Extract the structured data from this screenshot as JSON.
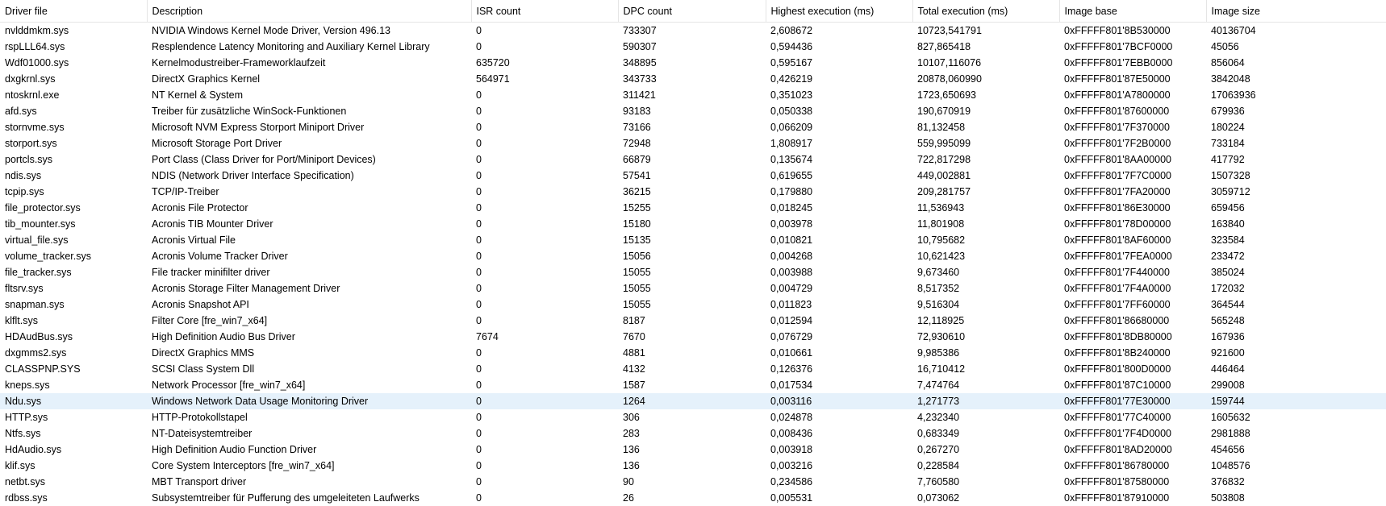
{
  "columns": [
    "Driver file",
    "Description",
    "ISR count",
    "DPC count",
    "Highest execution (ms)",
    "Total execution (ms)",
    "Image base",
    "Image size"
  ],
  "rows": [
    [
      "nvlddmkm.sys",
      "NVIDIA Windows Kernel Mode Driver, Version 496.13",
      "0",
      "733307",
      "2,608672",
      "10723,541791",
      "0xFFFFF801'8B530000",
      "40136704"
    ],
    [
      "rspLLL64.sys",
      "Resplendence Latency Monitoring and Auxiliary Kernel Library",
      "0",
      "590307",
      "0,594436",
      "827,865418",
      "0xFFFFF801'7BCF0000",
      "45056"
    ],
    [
      "Wdf01000.sys",
      "Kernelmodustreiber-Frameworklaufzeit",
      "635720",
      "348895",
      "0,595167",
      "10107,116076",
      "0xFFFFF801'7EBB0000",
      "856064"
    ],
    [
      "dxgkrnl.sys",
      "DirectX Graphics Kernel",
      "564971",
      "343733",
      "0,426219",
      "20878,060990",
      "0xFFFFF801'87E50000",
      "3842048"
    ],
    [
      "ntoskrnl.exe",
      "NT Kernel & System",
      "0",
      "311421",
      "0,351023",
      "1723,650693",
      "0xFFFFF801'A7800000",
      "17063936"
    ],
    [
      "afd.sys",
      "Treiber für zusätzliche WinSock-Funktionen",
      "0",
      "93183",
      "0,050338",
      "190,670919",
      "0xFFFFF801'87600000",
      "679936"
    ],
    [
      "stornvme.sys",
      "Microsoft NVM Express Storport Miniport Driver",
      "0",
      "73166",
      "0,066209",
      "81,132458",
      "0xFFFFF801'7F370000",
      "180224"
    ],
    [
      "storport.sys",
      "Microsoft Storage Port Driver",
      "0",
      "72948",
      "1,808917",
      "559,995099",
      "0xFFFFF801'7F2B0000",
      "733184"
    ],
    [
      "portcls.sys",
      "Port Class (Class Driver for Port/Miniport Devices)",
      "0",
      "66879",
      "0,135674",
      "722,817298",
      "0xFFFFF801'8AA00000",
      "417792"
    ],
    [
      "ndis.sys",
      "NDIS (Network Driver Interface Specification)",
      "0",
      "57541",
      "0,619655",
      "449,002881",
      "0xFFFFF801'7F7C0000",
      "1507328"
    ],
    [
      "tcpip.sys",
      "TCP/IP-Treiber",
      "0",
      "36215",
      "0,179880",
      "209,281757",
      "0xFFFFF801'7FA20000",
      "3059712"
    ],
    [
      "file_protector.sys",
      "Acronis File Protector",
      "0",
      "15255",
      "0,018245",
      "11,536943",
      "0xFFFFF801'86E30000",
      "659456"
    ],
    [
      "tib_mounter.sys",
      "Acronis TIB Mounter Driver",
      "0",
      "15180",
      "0,003978",
      "11,801908",
      "0xFFFFF801'78D00000",
      "163840"
    ],
    [
      "virtual_file.sys",
      "Acronis Virtual File",
      "0",
      "15135",
      "0,010821",
      "10,795682",
      "0xFFFFF801'8AF60000",
      "323584"
    ],
    [
      "volume_tracker.sys",
      "Acronis Volume Tracker Driver",
      "0",
      "15056",
      "0,004268",
      "10,621423",
      "0xFFFFF801'7FEA0000",
      "233472"
    ],
    [
      "file_tracker.sys",
      "File tracker minifilter driver",
      "0",
      "15055",
      "0,003988",
      "9,673460",
      "0xFFFFF801'7F440000",
      "385024"
    ],
    [
      "fltsrv.sys",
      "Acronis Storage Filter Management Driver",
      "0",
      "15055",
      "0,004729",
      "8,517352",
      "0xFFFFF801'7F4A0000",
      "172032"
    ],
    [
      "snapman.sys",
      "Acronis Snapshot API",
      "0",
      "15055",
      "0,011823",
      "9,516304",
      "0xFFFFF801'7FF60000",
      "364544"
    ],
    [
      "klflt.sys",
      "Filter Core [fre_win7_x64]",
      "0",
      "8187",
      "0,012594",
      "12,118925",
      "0xFFFFF801'86680000",
      "565248"
    ],
    [
      "HDAudBus.sys",
      "High Definition Audio Bus Driver",
      "7674",
      "7670",
      "0,076729",
      "72,930610",
      "0xFFFFF801'8DB80000",
      "167936"
    ],
    [
      "dxgmms2.sys",
      "DirectX Graphics MMS",
      "0",
      "4881",
      "0,010661",
      "9,985386",
      "0xFFFFF801'8B240000",
      "921600"
    ],
    [
      "CLASSPNP.SYS",
      "SCSI Class System Dll",
      "0",
      "4132",
      "0,126376",
      "16,710412",
      "0xFFFFF801'800D0000",
      "446464"
    ],
    [
      "kneps.sys",
      "Network Processor [fre_win7_x64]",
      "0",
      "1587",
      "0,017534",
      "7,474764",
      "0xFFFFF801'87C10000",
      "299008"
    ],
    [
      "Ndu.sys",
      "Windows Network Data Usage Monitoring Driver",
      "0",
      "1264",
      "0,003116",
      "1,271773",
      "0xFFFFF801'77E30000",
      "159744"
    ],
    [
      "HTTP.sys",
      "HTTP-Protokollstapel",
      "0",
      "306",
      "0,024878",
      "4,232340",
      "0xFFFFF801'77C40000",
      "1605632"
    ],
    [
      "Ntfs.sys",
      "NT-Dateisystemtreiber",
      "0",
      "283",
      "0,008436",
      "0,683349",
      "0xFFFFF801'7F4D0000",
      "2981888"
    ],
    [
      "HdAudio.sys",
      "High Definition Audio Function Driver",
      "0",
      "136",
      "0,003918",
      "0,267270",
      "0xFFFFF801'8AD20000",
      "454656"
    ],
    [
      "klif.sys",
      "Core System Interceptors [fre_win7_x64]",
      "0",
      "136",
      "0,003216",
      "0,228584",
      "0xFFFFF801'86780000",
      "1048576"
    ],
    [
      "netbt.sys",
      "MBT Transport driver",
      "0",
      "90",
      "0,234586",
      "7,760580",
      "0xFFFFF801'87580000",
      "376832"
    ],
    [
      "rdbss.sys",
      "Subsystemtreiber für Pufferung des umgeleiteten Laufwerks",
      "0",
      "26",
      "0,005531",
      "0,073062",
      "0xFFFFF801'87910000",
      "503808"
    ]
  ],
  "selected_row": 23,
  "colors": {
    "selection": "#e5f1fb",
    "header_divider": "#e5e5e5"
  }
}
